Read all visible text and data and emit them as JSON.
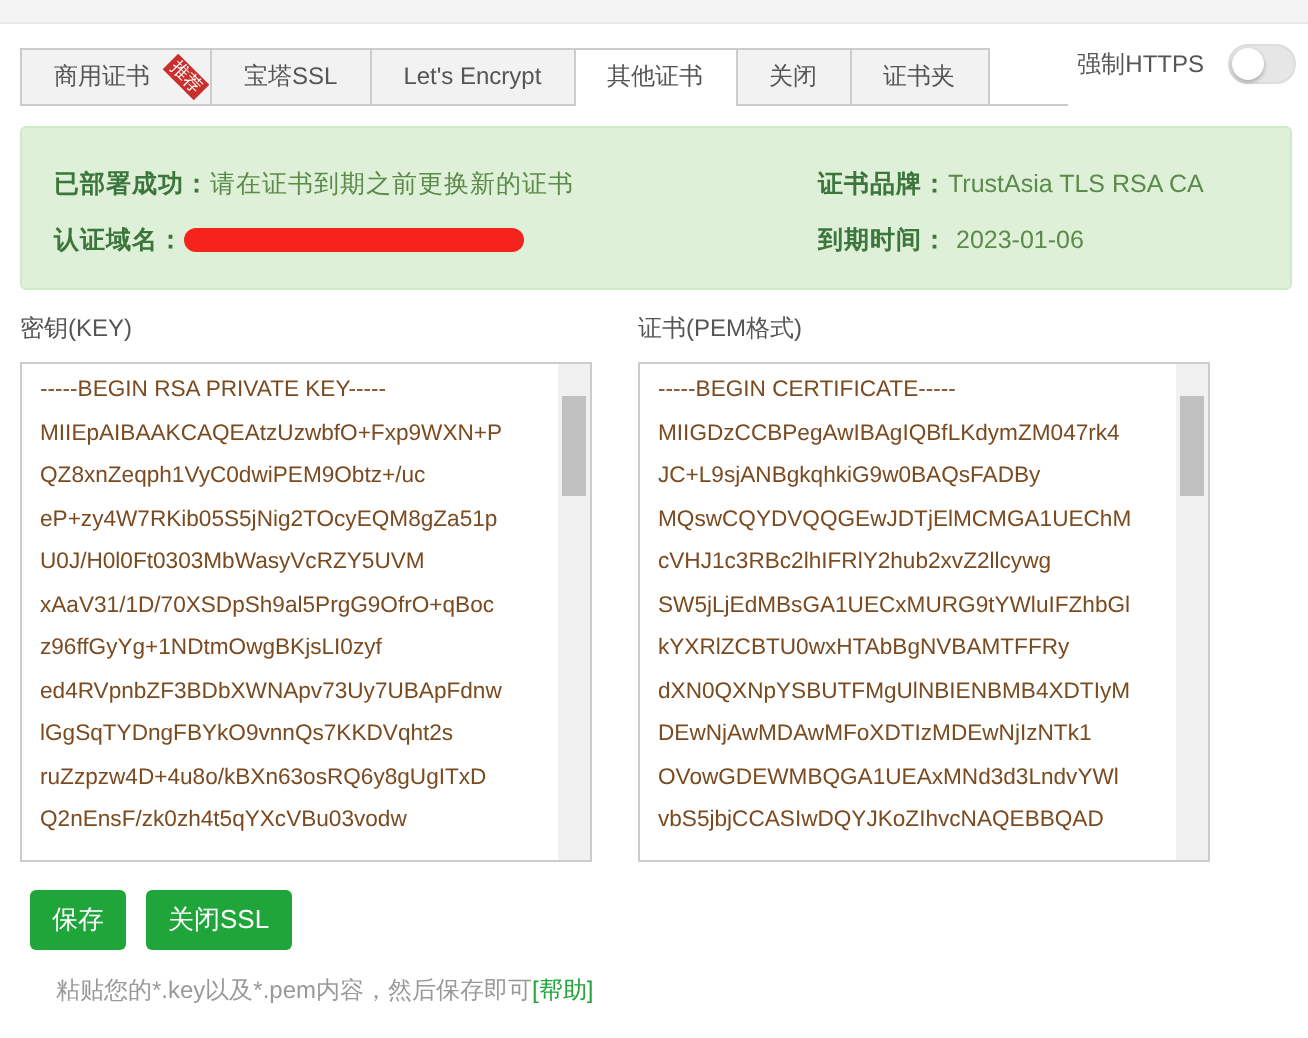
{
  "tabs": [
    {
      "label": "商用证书",
      "selected": false,
      "badge": "推荐"
    },
    {
      "label": "宝塔SSL",
      "selected": false
    },
    {
      "label": "Let's Encrypt",
      "selected": false
    },
    {
      "label": "其他证书",
      "selected": true
    },
    {
      "label": "关闭",
      "selected": false
    },
    {
      "label": "证书夹",
      "selected": false
    }
  ],
  "force_https": {
    "label": "强制HTTPS",
    "on": false
  },
  "status": {
    "deployed_label": "已部署成功：",
    "deployed_text": "请在证书到期之前更换新的证书",
    "domain_label": "认证域名：",
    "brand_label": "证书品牌：",
    "brand": "TrustAsia TLS RSA CA",
    "expiry_label": "到期时间：",
    "expiry": "2023-01-06"
  },
  "key": {
    "label": "密钥(KEY)",
    "lines": [
      "-----BEGIN RSA PRIVATE KEY-----",
      "MIIEpAIBAAKCAQEAtzUzwbfO+Fxp9WXN+P",
      "QZ8xnZeqph1VyC0dwiPEM9Obtz+/uc",
      "eP+zy4W7RKib05S5jNig2TOcyEQM8gZa51p",
      "U0J/H0l0Ft0303MbWasyVcRZY5UVM",
      "xAaV31/1D/70XSDpSh9al5PrgG9OfrO+qBoc",
      "z96ffGyYg+1NDtmOwgBKjsLI0zyf",
      "ed4RVpnbZF3BDbXWNApv73Uy7UBApFdnw",
      "lGgSqTYDngFBYkO9vnnQs7KKDVqht2s",
      "ruZzpzw4D+4u8o/kBXn63osRQ6y8gUgITxD",
      "Q2nEnsF/zk0zh4t5qYXcVBu03vodw"
    ]
  },
  "certificate": {
    "label": "证书(PEM格式)",
    "lines": [
      "-----BEGIN CERTIFICATE-----",
      "MIIGDzCCBPegAwIBAgIQBfLKdymZM047rk4",
      "JC+L9sjANBgkqhkiG9w0BAQsFADBy",
      "MQswCQYDVQQGEwJDTjElMCMGA1UEChM",
      "cVHJ1c3RBc2lhIFRlY2hub2xvZ2llcywg",
      "SW5jLjEdMBsGA1UECxMURG9tYWluIFZhbGl",
      "kYXRlZCBTU0wxHTAbBgNVBAMTFFRy",
      "dXN0QXNpYSBUTFMgUlNBIENBMB4XDTIyM",
      "DEwNjAwMDAwMFoXDTIzMDEwNjIzNTk1",
      "OVowGDEWMBQGA1UEAxMNd3d3LndvYWl",
      "vbS5jbjCCASIwDQYJKoZIhvcNAQEBBQAD"
    ]
  },
  "buttons": [
    "保存",
    "关闭SSL"
  ],
  "hint": {
    "text": "粘贴您的*.key以及*.pem内容，然后保存即可",
    "link": "[帮助]"
  }
}
